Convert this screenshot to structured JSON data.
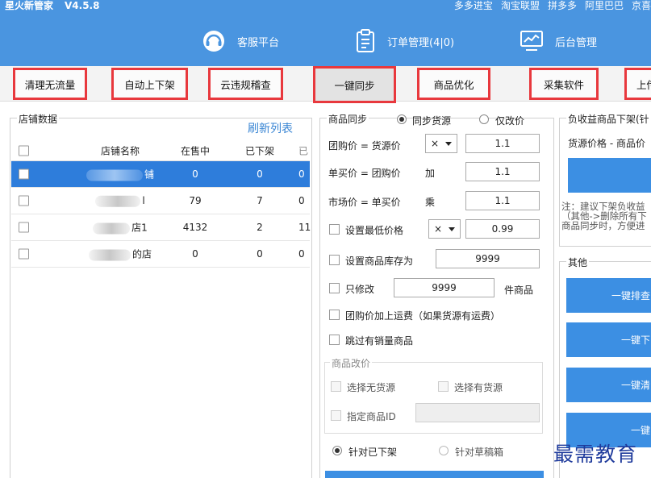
{
  "app": {
    "title": "星火新管家",
    "version": "V4.5.8",
    "top_links": [
      "多多进宝",
      "淘宝联盟",
      "拼多多",
      "阿里巴巴",
      "京喜"
    ]
  },
  "nav": {
    "customer_service": "客服平台",
    "orders": "订单管理(4|0)",
    "backend": "后台管理"
  },
  "tabs": [
    {
      "label": "清理无流量"
    },
    {
      "label": "自动上下架"
    },
    {
      "label": "云违规稽查"
    },
    {
      "label": "一键同步",
      "active": true
    },
    {
      "label": "商品优化"
    },
    {
      "label": "采集软件"
    },
    {
      "label": "上传"
    }
  ],
  "store_panel": {
    "title": "店铺数据",
    "refresh": "刷新列表",
    "headers": {
      "name": "店铺名称",
      "on_sale": "在售中",
      "off_shelf": "已下架",
      "extra": "已"
    },
    "rows": [
      {
        "name_suffix": "铺",
        "on_sale": "0",
        "off_shelf": "0",
        "extra": "0",
        "selected": true
      },
      {
        "name_suffix": "l",
        "on_sale": "79",
        "off_shelf": "7",
        "extra": "0"
      },
      {
        "name_suffix": "店1",
        "on_sale": "4132",
        "off_shelf": "2",
        "extra": "11"
      },
      {
        "name_suffix": "的店",
        "on_sale": "0",
        "off_shelf": "0",
        "extra": "0"
      }
    ]
  },
  "sync_panel": {
    "title": "商品同步",
    "mode_sync_source": "同步货源",
    "mode_price_only": "仅改价",
    "group_price_label": "团购价 = 货源价",
    "group_price_op": "×",
    "group_price_value": "1.1",
    "single_price_label": "单买价 = 团购价",
    "single_price_op": "加",
    "single_price_value": "1.1",
    "market_price_label": "市场价 = 单买价",
    "market_price_op": "乘",
    "market_price_value": "1.1",
    "min_price_label": "设置最低价格",
    "min_price_op": "×",
    "min_price_value": "0.99",
    "stock_label": "设置商品库存为",
    "stock_value": "9999",
    "only_modify_label": "只修改",
    "only_modify_value": "9999",
    "only_modify_suffix": "件商品",
    "add_freight_label": "团购价加上运费（如果货源有运费）",
    "skip_sold_label": "跳过有销量商品",
    "modify_group": {
      "title": "商品改价",
      "no_source": "选择无货源",
      "has_source": "选择有货源",
      "specify_id": "指定商品ID",
      "specify_id_value": ""
    },
    "target_off_shelf": "针对已下架",
    "target_draft": "针对草稿箱"
  },
  "right_panel": {
    "title": "负收益商品下架(针",
    "desc": "货源价格 - 商品价",
    "note_lines": [
      "注：建议下架负收益",
      "（其他->删除所有下",
      "商品同步时，方便进"
    ],
    "other_title": "其他",
    "buttons": [
      "一键排查",
      "一键下",
      "一键清",
      "一键"
    ]
  },
  "watermark": "最需教育"
}
